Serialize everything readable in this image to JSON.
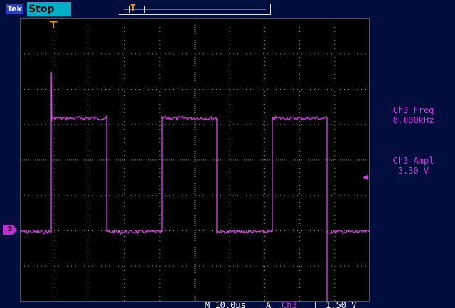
{
  "header": {
    "brand": "Tek",
    "run_state": "Stop"
  },
  "measurements": [
    {
      "label": "Ch3 Freq",
      "value": "8.000kHz"
    },
    {
      "label": "Ch3 Ampl",
      "value": "3.30 V"
    }
  ],
  "channel_marker": "3",
  "status": {
    "timebase": "M 10.0µs",
    "trigger_source_prefix": "A",
    "trigger_channel": "Ch3",
    "trigger_slope": "ʃ",
    "trigger_level": "1.50 V"
  },
  "colors": {
    "trace": "#e040f0",
    "trigger_marker": "#ff8c00",
    "grid": "#8a8a8a"
  },
  "icons": [
    "trigger-position-icon",
    "channel-3-marker-icon",
    "trigger-level-arrow-icon"
  ]
}
